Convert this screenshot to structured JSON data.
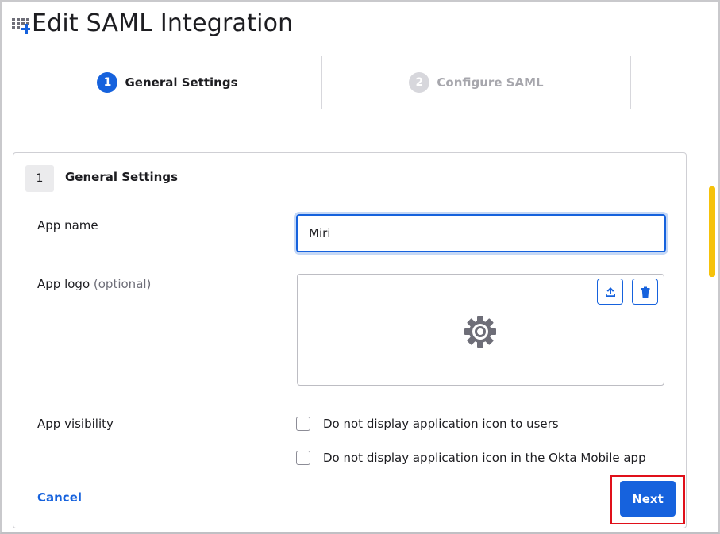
{
  "page": {
    "title": "Edit SAML Integration",
    "header_icon": "app-grid-add-icon"
  },
  "stepper": {
    "steps": [
      {
        "number": "1",
        "label": "General Settings",
        "state": "active"
      },
      {
        "number": "2",
        "label": "Configure SAML",
        "state": "inactive"
      }
    ]
  },
  "section": {
    "number": "1",
    "title": "General Settings"
  },
  "form": {
    "app_name_label": "App name",
    "app_name_value": "Miri",
    "app_logo_label": "App logo",
    "app_logo_optional": "(optional)",
    "app_logo_icons": [
      "upload-icon",
      "trash-icon",
      "gear-icon"
    ],
    "app_visibility_label": "App visibility",
    "visibility_options": [
      {
        "label": "Do not display application icon to users",
        "checked": false
      },
      {
        "label": "Do not display application icon in the Okta Mobile app",
        "checked": false
      }
    ]
  },
  "actions": {
    "cancel_label": "Cancel",
    "next_label": "Next"
  },
  "colors": {
    "primary": "#1662dd",
    "highlight": "#e0101a",
    "scrollbar": "#f6c20a",
    "inactive_step": "#d7d7dc"
  }
}
